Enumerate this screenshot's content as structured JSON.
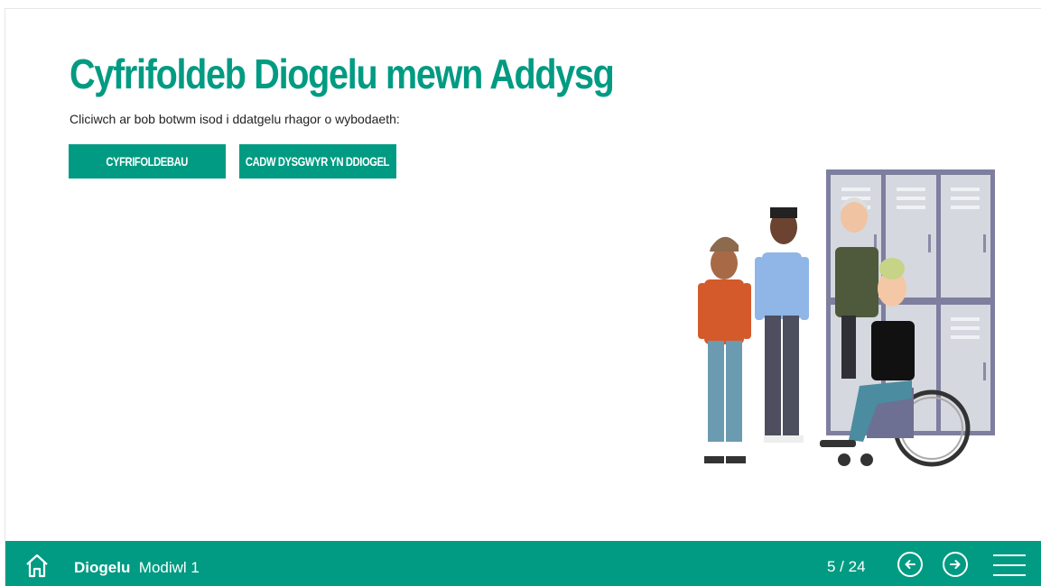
{
  "page": {
    "title": "Cyfrifoldeb Diogelu mewn Addysg",
    "intro": "Cliciwch ar bob botwm isod i ddatgelu rhagor o wybodaeth:"
  },
  "buttons": [
    {
      "label": "CYFRIFOLDEBAU"
    },
    {
      "label": "CADW DYSGWYR YN DDIOGEL"
    }
  ],
  "footer": {
    "course_bold": "Diogelu",
    "course_module": "Modiwl 1",
    "page_indicator": "5 / 24",
    "icons": [
      "home-icon",
      "prev-arrow-icon",
      "next-arrow-icon",
      "menu-icon"
    ]
  },
  "colors": {
    "accent": "#009b82",
    "text": "#222222",
    "background": "#ffffff"
  }
}
